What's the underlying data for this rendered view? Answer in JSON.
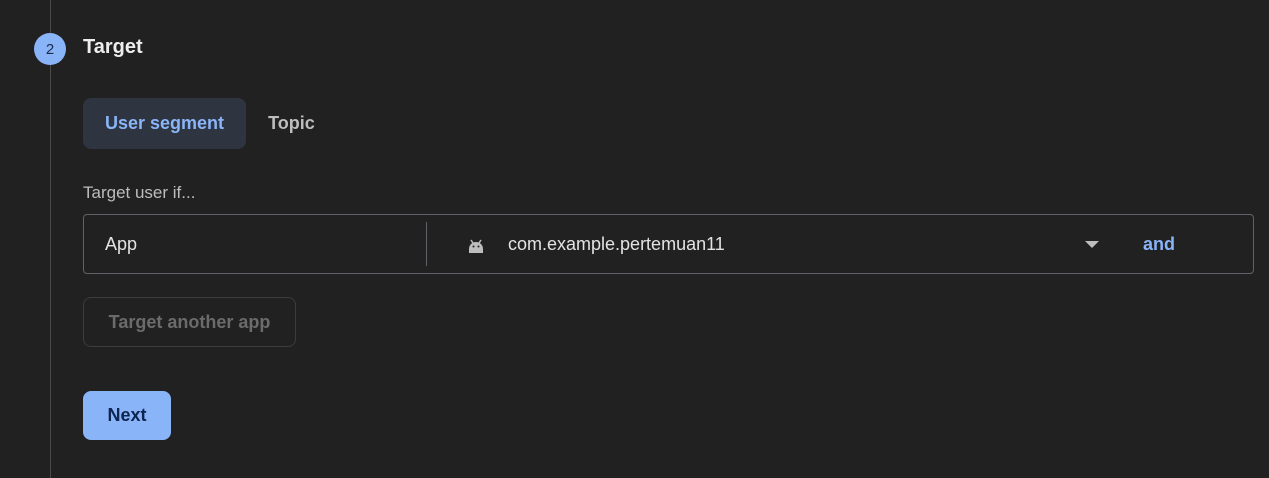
{
  "step": {
    "number": "2",
    "title": "Target"
  },
  "tabs": [
    {
      "label": "User segment",
      "active": true
    },
    {
      "label": "Topic",
      "active": false
    }
  ],
  "target_label": "Target user if...",
  "condition": {
    "field": "App",
    "platform_icon": "android-icon",
    "package": "com.example.pertemuan11",
    "and_label": "and"
  },
  "buttons": {
    "target_another": "Target another app",
    "next": "Next"
  },
  "colors": {
    "background": "#212121",
    "accent": "#8ab4f8",
    "active_tab_bg": "#2e3440",
    "border": "#5f6368"
  }
}
